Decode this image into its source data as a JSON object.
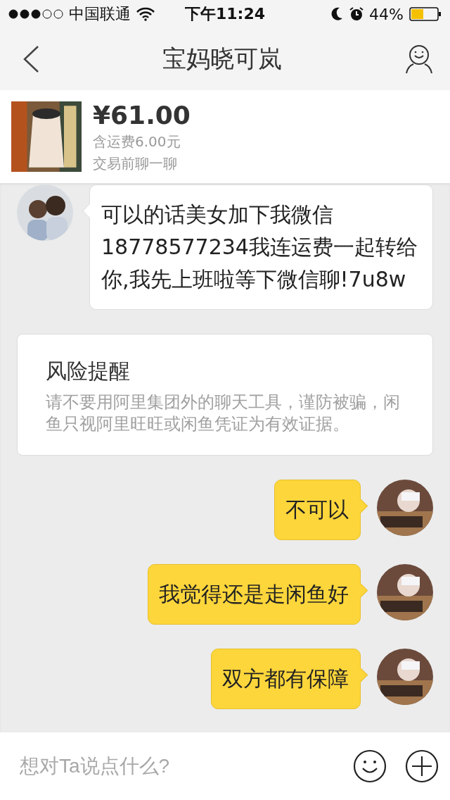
{
  "status_bar": {
    "carrier": "中国联通",
    "time": "下午11:24",
    "battery": "44%"
  },
  "nav": {
    "title": "宝妈晓可岚"
  },
  "product": {
    "price": "¥61.00",
    "shipping": "含运费6.00元",
    "hint": "交易前聊一聊"
  },
  "messages": [
    {
      "kind": "incoming",
      "text": "可以的话美女加下我微信18778577234我连运费一起转给你,我先上班啦等下微信聊!7u8w"
    },
    {
      "kind": "notice",
      "title": "风险提醒",
      "text": "请不要用阿里集团外的聊天工具，谨防被骗，闲鱼只视阿里旺旺或闲鱼凭证为有效证据。"
    },
    {
      "kind": "outgoing",
      "text": "不可以"
    },
    {
      "kind": "outgoing",
      "text": "我觉得还是走闲鱼好"
    },
    {
      "kind": "outgoing",
      "text": "双方都有保障"
    }
  ],
  "composer": {
    "placeholder": "想对Ta说点什么?"
  }
}
